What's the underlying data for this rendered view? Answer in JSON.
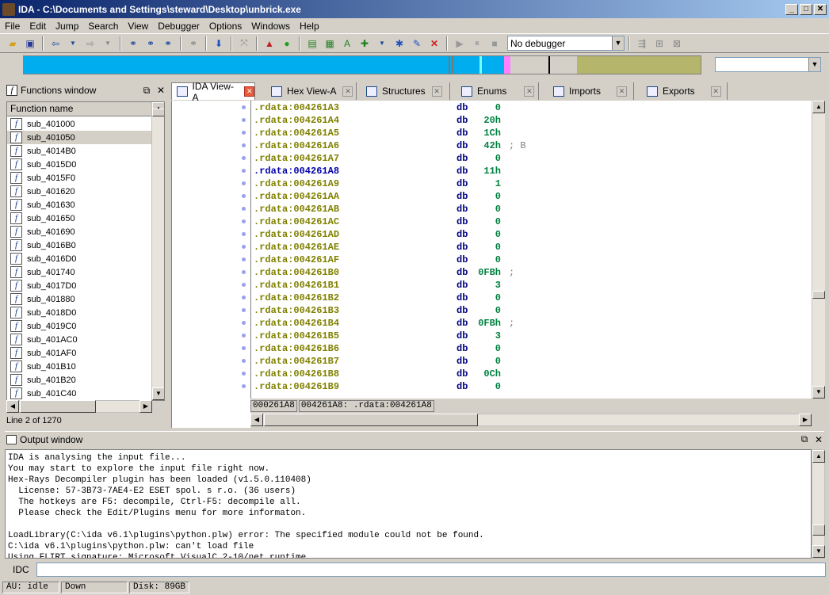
{
  "window": {
    "title": "IDA - C:\\Documents and Settings\\steward\\Desktop\\unbrick.exe",
    "min": "_",
    "max": "□",
    "close": "✕"
  },
  "menu": [
    "File",
    "Edit",
    "Jump",
    "Search",
    "View",
    "Debugger",
    "Options",
    "Windows",
    "Help"
  ],
  "toolbar": {
    "debugger": "No debugger"
  },
  "functions_window": {
    "title": "Functions window",
    "column": "Function name",
    "items": [
      "sub_401000",
      "sub_401050",
      "sub_4014B0",
      "sub_4015D0",
      "sub_4015F0",
      "sub_401620",
      "sub_401630",
      "sub_401650",
      "sub_401690",
      "sub_4016B0",
      "sub_4016D0",
      "sub_401740",
      "sub_4017D0",
      "sub_401880",
      "sub_4018D0",
      "sub_4019C0",
      "sub_401AC0",
      "sub_401AF0",
      "sub_401B10",
      "sub_401B20",
      "sub_401C40"
    ],
    "selected_index": 1,
    "status": "Line 2 of 1270"
  },
  "tabs": [
    {
      "label": "IDA View-A",
      "active": true
    },
    {
      "label": "Hex View-A",
      "active": false
    },
    {
      "label": "Structures",
      "active": false
    },
    {
      "label": "Enums",
      "active": false
    },
    {
      "label": "Imports",
      "active": false
    },
    {
      "label": "Exports",
      "active": false
    }
  ],
  "code_lines": [
    {
      "addr": ".rdata:004261A3",
      "mn": "db",
      "op": "0",
      "cm": ""
    },
    {
      "addr": ".rdata:004261A4",
      "mn": "db",
      "op": "20h",
      "cm": ""
    },
    {
      "addr": ".rdata:004261A5",
      "mn": "db",
      "op": "1Ch",
      "cm": ""
    },
    {
      "addr": ".rdata:004261A6",
      "mn": "db",
      "op": "42h",
      "cm": "; B"
    },
    {
      "addr": ".rdata:004261A7",
      "mn": "db",
      "op": "0",
      "cm": ""
    },
    {
      "addr": ".rdata:004261A8",
      "mn": "db",
      "op": "11h",
      "cm": "",
      "current": true
    },
    {
      "addr": ".rdata:004261A9",
      "mn": "db",
      "op": "1",
      "cm": ""
    },
    {
      "addr": ".rdata:004261AA",
      "mn": "db",
      "op": "0",
      "cm": ""
    },
    {
      "addr": ".rdata:004261AB",
      "mn": "db",
      "op": "0",
      "cm": ""
    },
    {
      "addr": ".rdata:004261AC",
      "mn": "db",
      "op": "0",
      "cm": ""
    },
    {
      "addr": ".rdata:004261AD",
      "mn": "db",
      "op": "0",
      "cm": ""
    },
    {
      "addr": ".rdata:004261AE",
      "mn": "db",
      "op": "0",
      "cm": ""
    },
    {
      "addr": ".rdata:004261AF",
      "mn": "db",
      "op": "0",
      "cm": ""
    },
    {
      "addr": ".rdata:004261B0",
      "mn": "db",
      "op": "0FBh",
      "cm": ";"
    },
    {
      "addr": ".rdata:004261B1",
      "mn": "db",
      "op": "3",
      "cm": ""
    },
    {
      "addr": ".rdata:004261B2",
      "mn": "db",
      "op": "0",
      "cm": ""
    },
    {
      "addr": ".rdata:004261B3",
      "mn": "db",
      "op": "0",
      "cm": ""
    },
    {
      "addr": ".rdata:004261B4",
      "mn": "db",
      "op": "0FBh",
      "cm": ";"
    },
    {
      "addr": ".rdata:004261B5",
      "mn": "db",
      "op": "3",
      "cm": ""
    },
    {
      "addr": ".rdata:004261B6",
      "mn": "db",
      "op": "0",
      "cm": ""
    },
    {
      "addr": ".rdata:004261B7",
      "mn": "db",
      "op": "0",
      "cm": ""
    },
    {
      "addr": ".rdata:004261B8",
      "mn": "db",
      "op": "0Ch",
      "cm": ""
    },
    {
      "addr": ".rdata:004261B9",
      "mn": "db",
      "op": "0",
      "cm": ""
    }
  ],
  "code_status": {
    "offset": "000261A8",
    "location": "004261A8: .rdata:004261A8"
  },
  "output_window": {
    "title": "Output window",
    "lines": [
      "IDA is analysing the input file...",
      "You may start to explore the input file right now.",
      "Hex-Rays Decompiler plugin has been loaded (v1.5.0.110408)",
      "  License: 57-3B73-7AE4-E2 ESET spol. s r.o. (36 users)",
      "  The hotkeys are F5: decompile, Ctrl-F5: decompile all.",
      "  Please check the Edit/Plugins menu for more informaton.",
      "",
      "LoadLibrary(C:\\ida v6.1\\plugins\\python.plw) error: The specified module could not be found.",
      "C:\\ida v6.1\\plugins\\python.plw: can't load file",
      "Using FLIRT signature: Microsoft VisualC 2-10/net runtime"
    ]
  },
  "idc": {
    "label": "IDC",
    "value": ""
  },
  "status": {
    "au": "AU:  idle",
    "dir": "Down",
    "disk": "Disk: 89GB"
  }
}
